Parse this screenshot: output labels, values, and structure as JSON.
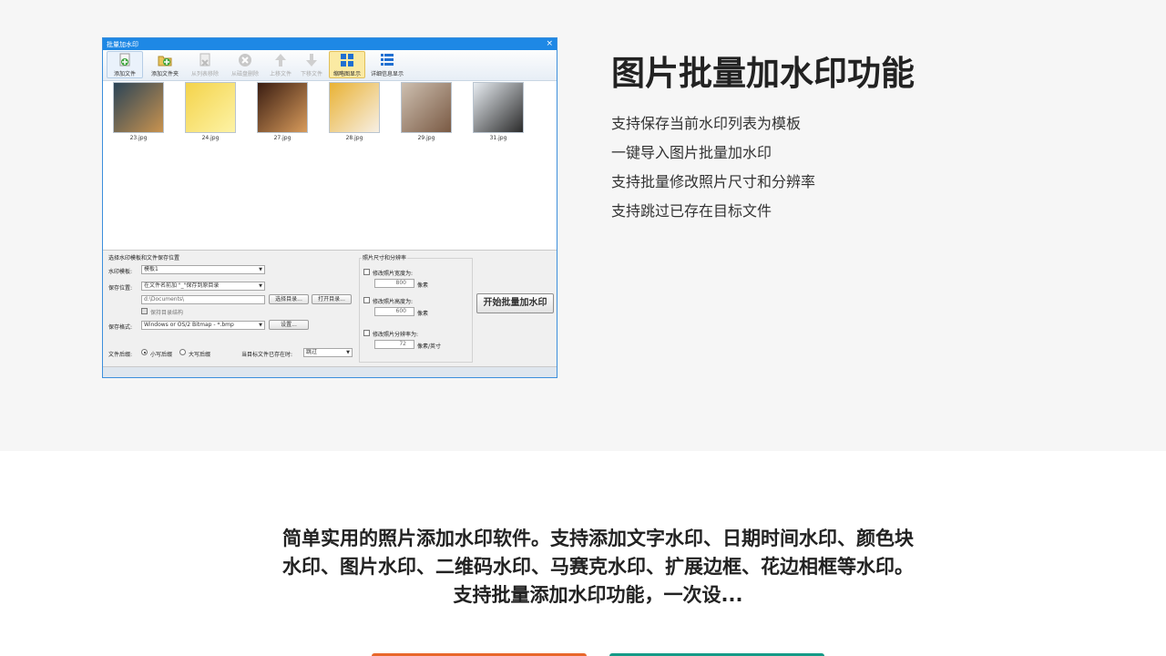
{
  "app_window": {
    "title": "批量加水印",
    "close_glyph": "×",
    "toolbar": [
      {
        "label": "添加文件",
        "icon": "add-file-icon",
        "state": "normal"
      },
      {
        "label": "添加文件夹",
        "icon": "add-folder-icon",
        "state": "normal"
      },
      {
        "label": "从列表移除",
        "icon": "remove-from-list-icon",
        "state": "disabled"
      },
      {
        "label": "从磁盘删除",
        "icon": "delete-from-disk-icon",
        "state": "disabled"
      },
      {
        "label": "上移文件",
        "icon": "move-up-icon",
        "state": "disabled"
      },
      {
        "label": "下移文件",
        "icon": "move-down-icon",
        "state": "disabled"
      },
      {
        "label": "缩略图显示",
        "icon": "thumbnail-view-icon",
        "state": "active"
      },
      {
        "label": "详细信息显示",
        "icon": "details-view-icon",
        "state": "normal"
      }
    ],
    "thumbnails": [
      {
        "name": "23.jpg",
        "colors": [
          "#2b4457",
          "#c9934f"
        ]
      },
      {
        "name": "24.jpg",
        "colors": [
          "#f4d34a",
          "#fdf3a6"
        ]
      },
      {
        "name": "27.jpg",
        "colors": [
          "#3a1d12",
          "#d89b5b"
        ]
      },
      {
        "name": "28.jpg",
        "colors": [
          "#e9b234",
          "#f7efe4"
        ]
      },
      {
        "name": "29.jpg",
        "colors": [
          "#cdbfb0",
          "#7a5a44"
        ]
      },
      {
        "name": "31.jpg",
        "colors": [
          "#e7ecf1",
          "#2b2b2b"
        ]
      }
    ],
    "settings": {
      "group_title": "选择水印模板和文件保存位置",
      "template_label": "水印模板:",
      "template_value": "模板1",
      "save_location_label": "保存位置:",
      "save_location_value": "在文件名前加 \"_\"保存到原目录",
      "path_value": "d:\\Documents\\",
      "choose_dir_button": "选择目录...",
      "open_dir_button": "打开目录...",
      "keep_structure_label": "保持目录结构",
      "format_label": "保存格式:",
      "format_value": "Windows or OS/2 Bitmap - *.bmp",
      "format_settings_button": "设置...",
      "ext_label": "文件后缀:",
      "ext_lower": "小写后缀",
      "ext_upper": "大写后缀",
      "exists_label": "当目标文件已存在时:",
      "exists_value": "跳过"
    },
    "resize": {
      "group_title": "照片尺寸和分辨率",
      "width_label": "修改照片宽度为:",
      "width_value": "800",
      "height_label": "修改照片高度为:",
      "height_value": "600",
      "px_unit": "像素",
      "dpi_label": "修改照片分辨率为:",
      "dpi_value": "72",
      "dpi_unit": "像素/英寸"
    },
    "start_button": "开始批量加水印"
  },
  "feature": {
    "title": "图片批量加水印功能",
    "items": [
      "支持保存当前水印列表为模板",
      "一键导入图片批量加水印",
      "支持批量修改照片尺寸和分辨率",
      "支持跳过已存在目标文件"
    ]
  },
  "description": "简单实用的照片添加水印软件。支持添加文字水印、日期时间水印、颜色块水印、图片水印、二维码水印、马赛克水印、扩展边框、花边相框等水印。支持批量添加水印功能，一次设..."
}
